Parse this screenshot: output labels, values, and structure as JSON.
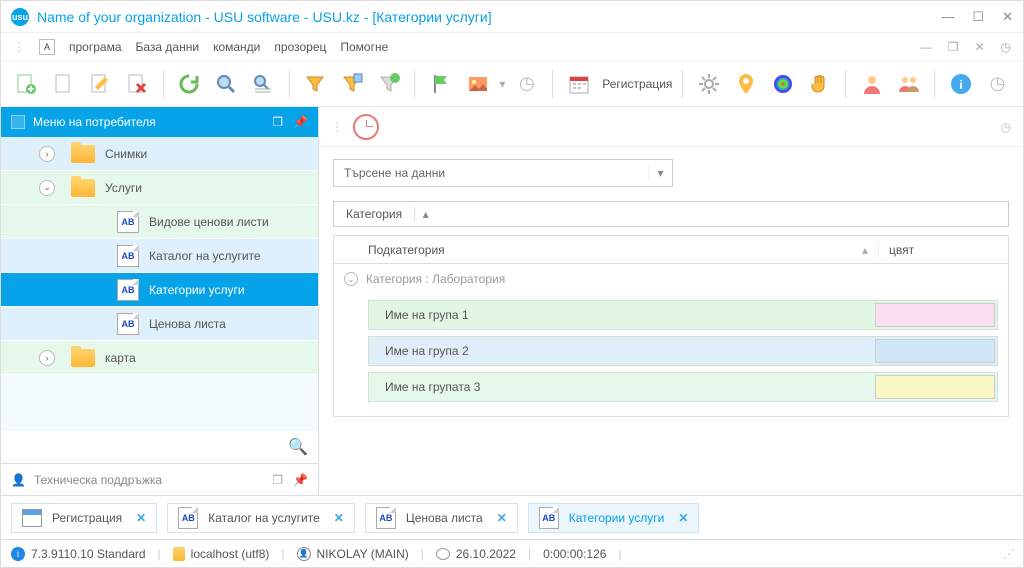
{
  "window": {
    "title": "Name of your organization - USU software - USU.kz - [Категории услуги]"
  },
  "menu": {
    "items": [
      "програма",
      "База данни",
      "команди",
      "прозорец",
      "Помогне"
    ]
  },
  "toolbar": {
    "registration": "Регистрация"
  },
  "sidebar": {
    "title": "Меню на потребителя",
    "items": [
      {
        "label": "Снимки"
      },
      {
        "label": "Услуги"
      },
      {
        "label": "Видове ценови листи"
      },
      {
        "label": "Каталог на услугите"
      },
      {
        "label": "Категории услуги"
      },
      {
        "label": "Ценова листа"
      },
      {
        "label": "карта"
      }
    ],
    "support": "Техническа поддръжка"
  },
  "content": {
    "search_label": "Търсене на данни",
    "category_label": "Категория",
    "columns": {
      "subcat": "Подкатегория",
      "color": "цвят"
    },
    "group_label": "Категория : Лаборатория",
    "rows": [
      {
        "name": "Име на група 1"
      },
      {
        "name": "Име на група 2"
      },
      {
        "name": "Име на групата 3"
      }
    ]
  },
  "tabs": [
    {
      "label": "Регистрация",
      "icon": "cal"
    },
    {
      "label": "Каталог на услугите",
      "icon": "ab"
    },
    {
      "label": "Ценова листа",
      "icon": "ab"
    },
    {
      "label": "Категории услуги",
      "icon": "ab",
      "active": true
    }
  ],
  "status": {
    "version": "7.3.9110.10 Standard",
    "host": "localhost (utf8)",
    "user": "NIKOLAY (MAIN)",
    "date": "26.10.2022",
    "timer": "0:00:00:126"
  },
  "ab_text": "AB"
}
